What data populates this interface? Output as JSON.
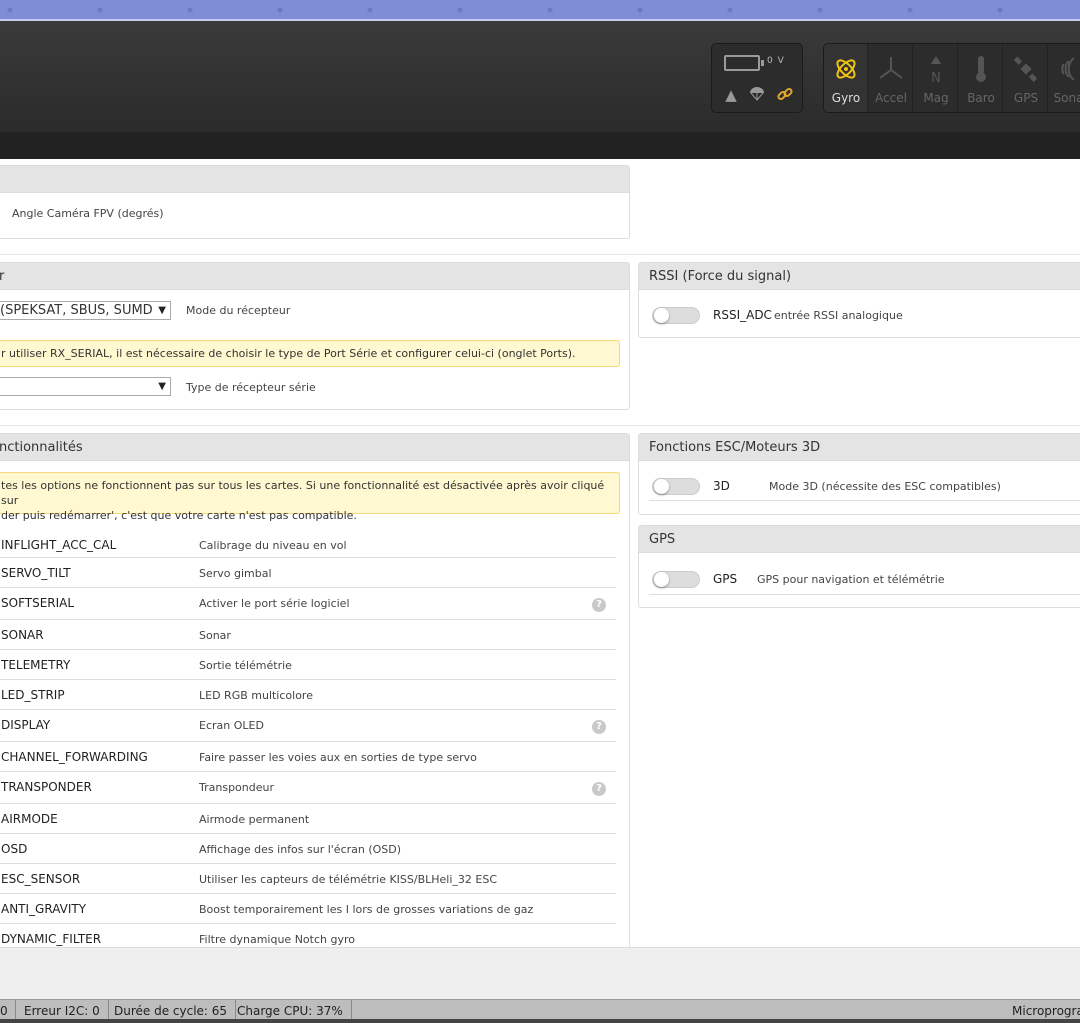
{
  "battery": {
    "voltage": "0 V"
  },
  "sensors": [
    {
      "label": "Gyro",
      "icon": "gyro-icon",
      "active": true
    },
    {
      "label": "Accel",
      "icon": "accel-icon",
      "active": false
    },
    {
      "label": "Mag",
      "icon": "mag-icon",
      "active": false
    },
    {
      "label": "Baro",
      "icon": "baro-icon",
      "active": false
    },
    {
      "label": "GPS",
      "icon": "gps-icon",
      "active": false
    },
    {
      "label": "Sonar",
      "icon": "sonar-icon",
      "active": false
    }
  ],
  "camera": {
    "angle_label": "Angle Caméra FPV (degrés)"
  },
  "receiver": {
    "title": "r",
    "mode_value": "(SPEKSAT, SBUS, SUMD",
    "mode_label": "Mode du récepteur",
    "note": "r utiliser RX_SERIAL, il est nécessaire de choisir le type de Port Série et configurer celui-ci (onglet Ports).",
    "serial_label": "Type de récepteur série"
  },
  "rssi": {
    "title": "RSSI (Force du signal)",
    "name": "RSSI_ADC",
    "desc": "entrée RSSI analogique"
  },
  "features": {
    "title": "nctionnalités",
    "note_line1": "tes les options ne fonctionnent pas sur tous les cartes. Si une fonctionnalité est désactivée après avoir cliqué sur",
    "note_line2": "der puis redémarrer', c'est que votre carte n'est pas compatible.",
    "rows": [
      {
        "name": "INFLIGHT_ACC_CAL",
        "desc": "Calibrage du niveau en vol"
      },
      {
        "name": "SERVO_TILT",
        "desc": "Servo gimbal"
      },
      {
        "name": "SOFTSERIAL",
        "desc": "Activer le port série logiciel"
      },
      {
        "name": "SONAR",
        "desc": "Sonar"
      },
      {
        "name": "TELEMETRY",
        "desc": "Sortie télémétrie"
      },
      {
        "name": "LED_STRIP",
        "desc": "LED RGB multicolore"
      },
      {
        "name": "DISPLAY",
        "desc": "Ecran OLED"
      },
      {
        "name": "CHANNEL_FORWARDING",
        "desc": "Faire passer les voies aux en sorties de type servo"
      },
      {
        "name": "TRANSPONDER",
        "desc": "Transpondeur"
      },
      {
        "name": "AIRMODE",
        "desc": "Airmode permanent"
      },
      {
        "name": "OSD",
        "desc": "Affichage des infos sur l'écran (OSD)"
      },
      {
        "name": "ESC_SENSOR",
        "desc": "Utiliser les capteurs de télémétrie KISS/BLHeli_32 ESC"
      },
      {
        "name": "ANTI_GRAVITY",
        "desc": "Boost temporairement les I lors de grosses variations de gaz"
      },
      {
        "name": "DYNAMIC_FILTER",
        "desc": "Filtre dynamique Notch gyro"
      }
    ],
    "help_symbol": "?"
  },
  "esc3d": {
    "title": "Fonctions ESC/Moteurs 3D",
    "name": "3D",
    "desc": "Mode 3D (nécessite des ESC compatibles)"
  },
  "gps": {
    "title": "GPS",
    "name": "GPS",
    "desc": "GPS pour navigation et télémétrie"
  },
  "status": {
    "first": "0",
    "i2c": "Erreur I2C: 0",
    "cycle": "Durée de cycle: 65",
    "cpu": "Charge CPU: 37%",
    "firmware": "Microprogra"
  }
}
